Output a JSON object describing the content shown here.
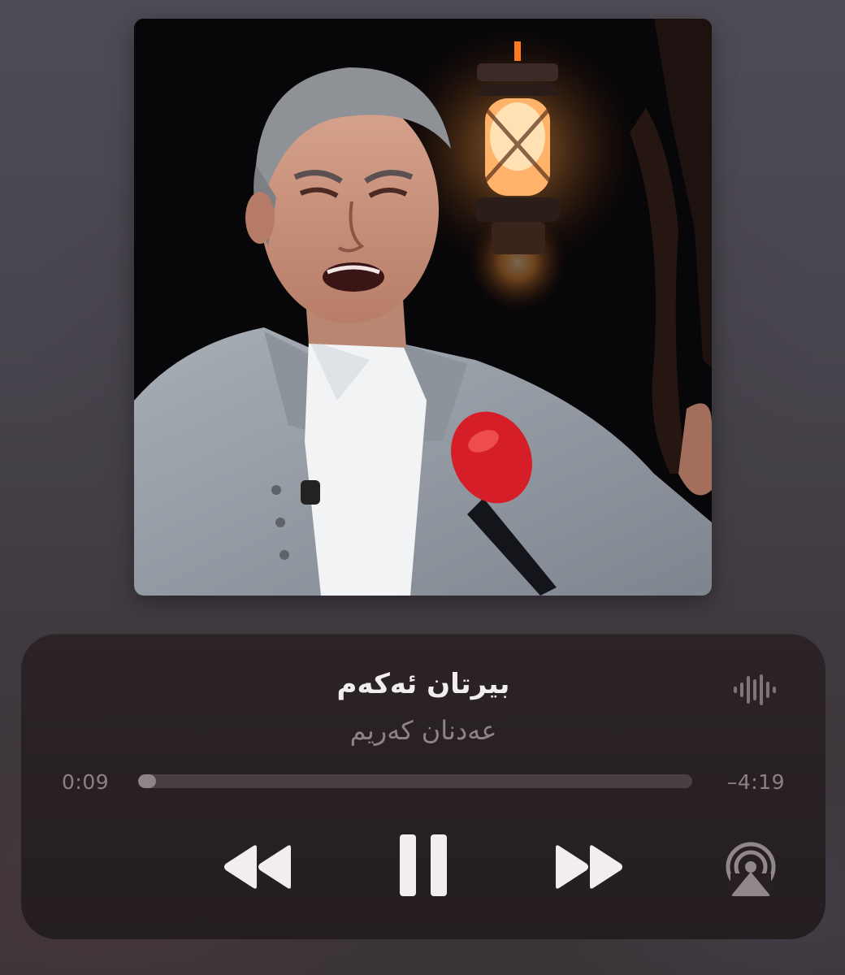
{
  "now_playing": {
    "title": "بیرتان ئەکەم",
    "artist": "عەدنان کەریم",
    "elapsed": "0:09",
    "remaining": "–4:19",
    "progress_fraction": 0.032
  },
  "controls": {
    "rewind_icon": "backward-icon",
    "pause_icon": "pause-icon",
    "forward_icon": "forward-icon",
    "airplay_icon": "airplay-audio-icon",
    "waveform_icon": "waveform-icon"
  },
  "colors": {
    "control_fill": "#f2eef0",
    "airplay_fill": "#8f878b",
    "waveform_fill": "#7d7579"
  }
}
